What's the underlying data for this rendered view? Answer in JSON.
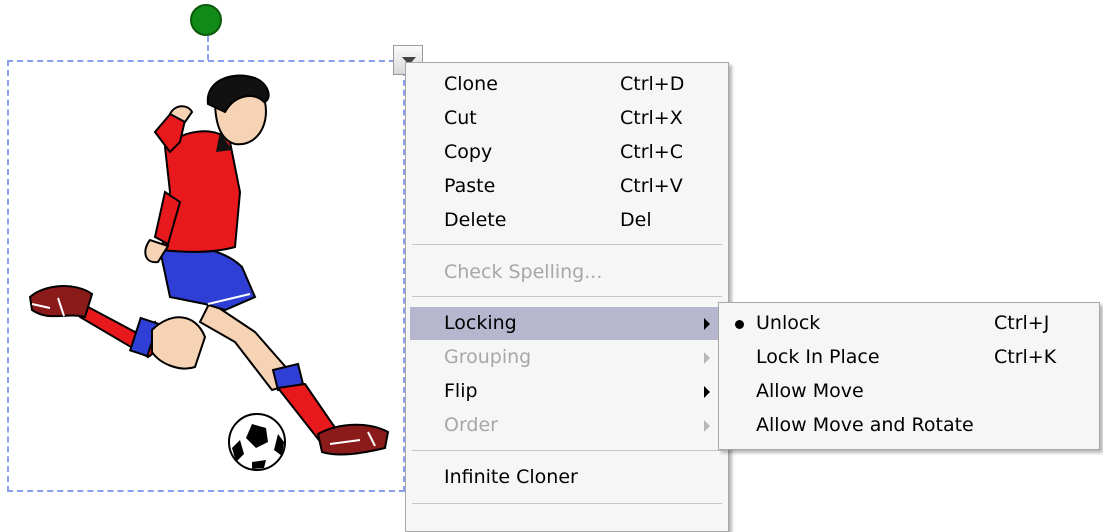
{
  "context_menu": {
    "items": [
      {
        "label": "Clone",
        "shortcut": "Ctrl+D"
      },
      {
        "label": "Cut",
        "shortcut": "Ctrl+X"
      },
      {
        "label": "Copy",
        "shortcut": "Ctrl+C"
      },
      {
        "label": "Paste",
        "shortcut": "Ctrl+V"
      },
      {
        "label": "Delete",
        "shortcut": "Del"
      },
      {
        "label": "Check Spelling...",
        "state": "disabled"
      },
      {
        "label": "Locking",
        "state": "highlighted",
        "has_submenu": true
      },
      {
        "label": "Grouping",
        "state": "disabled",
        "has_submenu": true
      },
      {
        "label": "Flip",
        "has_submenu": true
      },
      {
        "label": "Order",
        "state": "disabled",
        "has_submenu": true
      },
      {
        "label": "Infinite Cloner"
      }
    ]
  },
  "locking_submenu": {
    "items": [
      {
        "label": "Unlock",
        "shortcut": "Ctrl+J",
        "selected": true
      },
      {
        "label": "Lock In Place",
        "shortcut": "Ctrl+K"
      },
      {
        "label": "Allow Move",
        "shortcut": ""
      },
      {
        "label": "Allow Move and Rotate",
        "shortcut": ""
      }
    ]
  },
  "object": {
    "image_subject": "soccer-player-kicking-ball",
    "colors": {
      "selection_border": "#8c9ef0",
      "rotate_handle": "#128a17",
      "shirt": "#e8191c",
      "shorts": "#2f3fd6",
      "menu_highlight": "#b7b6cf"
    }
  }
}
